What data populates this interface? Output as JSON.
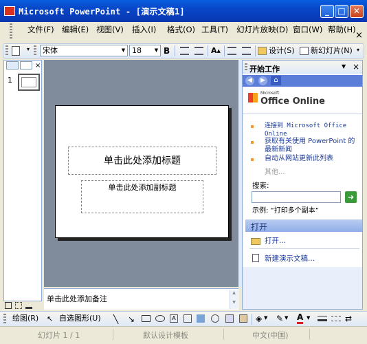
{
  "window": {
    "title": "Microsoft PowerPoint - [演示文稿1]",
    "minimize": "_",
    "maximize": "□",
    "close": "✕"
  },
  "menu": {
    "items": [
      "文件(F)",
      "编辑(E)",
      "视图(V)",
      "插入(I)",
      "格式(O)",
      "工具(T)",
      "幻灯片放映(D)",
      "窗口(W)",
      "帮助(H)"
    ],
    "doc_close": "×"
  },
  "toolbar": {
    "font": "宋体",
    "size": "18",
    "bold": "B",
    "design": "设计(S)",
    "new_slide": "新幻灯片(N)"
  },
  "thumbs": {
    "slide_number": "1"
  },
  "slide": {
    "title_placeholder": "单击此处添加标题",
    "subtitle_placeholder": "单击此处添加副标题"
  },
  "notes": {
    "placeholder": "单击此处添加备注"
  },
  "taskpane": {
    "title": "开始工作",
    "office_small": "Microsoft",
    "office_big": "Office Online",
    "links": [
      "连接到 Microsoft Office Online",
      "获取有关使用 PowerPoint 的最新新闻",
      "自动从网站更新此列表"
    ],
    "more": "其他...",
    "search_label": "搜索:",
    "search_value": "",
    "example": "示例: “打印多个副本”",
    "open_header": "打开",
    "open_link": "打开...",
    "new_link": "新建演示文稿..."
  },
  "drawing": {
    "draw": "绘图(R)",
    "autoshapes": "自选图形(U)"
  },
  "status": {
    "slide": "幻灯片 1 / 1",
    "design": "默认设计模板",
    "lang": "中文(中国)"
  },
  "colors": {
    "title_bar": "#0846c8",
    "canvas": "#808c9c",
    "accent_link": "#1a3a9a",
    "search_go": "#3a9a3a"
  }
}
